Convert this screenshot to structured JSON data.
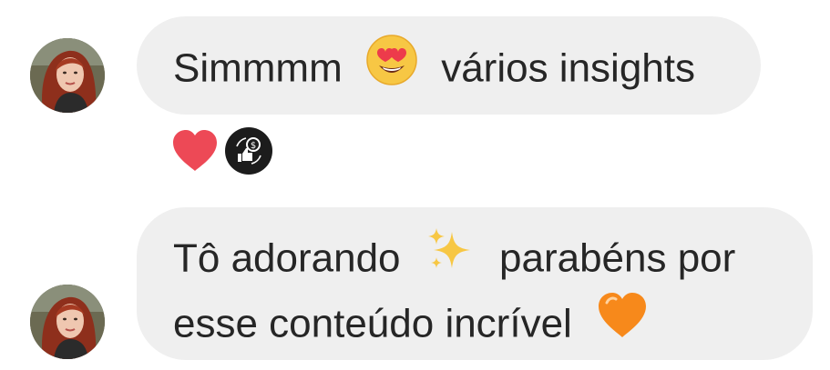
{
  "thread": {
    "messages": [
      {
        "sender_avatar": "avatar-red-haired-woman",
        "text_before_emoji": "Simmmm",
        "emoji_1": "smiling-face-with-heart-eyes",
        "text_after_emoji": "vários insights",
        "reactions": [
          "red-heart",
          "money-like-exchange"
        ]
      },
      {
        "sender_avatar": "avatar-red-haired-woman",
        "line1_before_emoji": "Tô adorando",
        "emoji_1": "sparkles",
        "line1_after_emoji": "parabéns por",
        "line2_before_emoji": "esse conteúdo incrível",
        "emoji_2": "orange-heart"
      }
    ]
  },
  "colors": {
    "bubble_bg": "#efefef",
    "text": "#262626",
    "heart_red": "#ed4956",
    "orange_heart": "#f7891b",
    "sparkles": "#f7c744",
    "reaction_badge": "#1c1c1c"
  }
}
